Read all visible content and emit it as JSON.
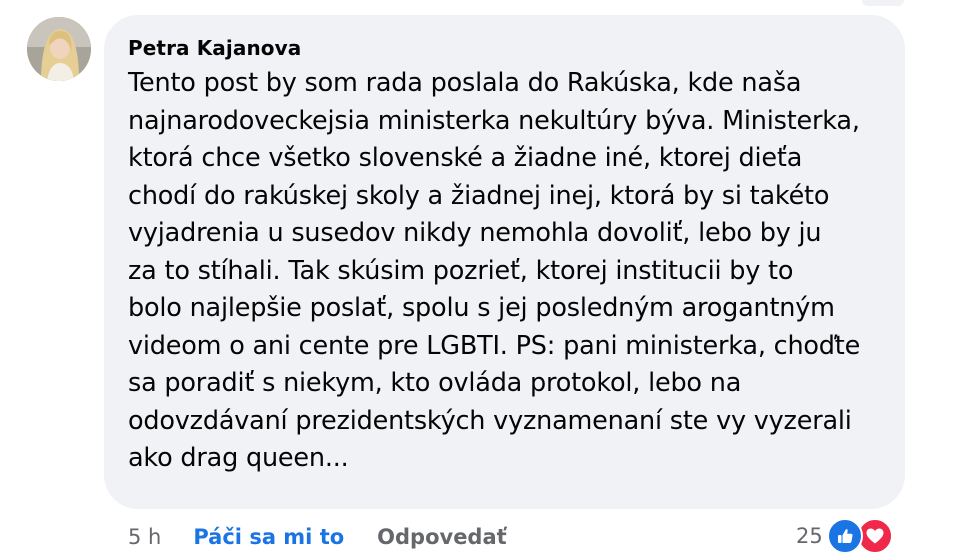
{
  "comment": {
    "author": "Petra Kajanova",
    "text": "Tento post by som rada poslala do Rakúska, kde naša\nnajnarodoveckejsia ministerka nekultúry býva. Ministerka,\nktorá chce všetko slovenské a žiadne iné, ktorej dieťa\nchodí do rakúskej skoly a žiadnej inej, ktorá by si takéto\nvyjadrenia u susedov nikdy nemohla dovoliť, lebo by ju\nza to stíhali. Tak skúsim pozrieť, ktorej institucii by to\nbolo najlepšie poslať, spolu s jej posledným arogantným\nvideom o ani cente pre LGBTI. PS: pani ministerka, choďte\nsa poradiť s niekym, kto ovláda protokol, lebo na\nodovzdávaní prezidentských vyznamenaní ste vy vyzerali\nako drag queen..."
  },
  "actions": {
    "time": "5 h",
    "like_label": "Páči sa mi to",
    "reply_label": "Odpovedať"
  },
  "reactions": {
    "count": "25",
    "types": [
      "like-icon",
      "love-icon"
    ],
    "like_color": "#1b74e4",
    "love_color": "#f0284a"
  },
  "colors": {
    "bubble": "#f0f2f5",
    "text": "#050505",
    "secondary": "#65676b",
    "link_active": "#1b74e4"
  }
}
